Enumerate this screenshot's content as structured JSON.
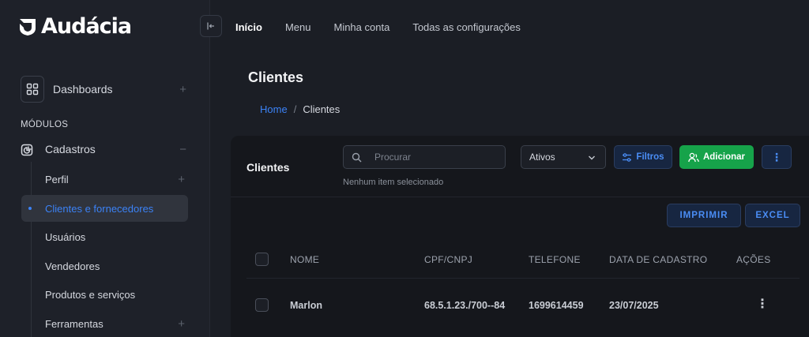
{
  "brand": {
    "name": "Audácia"
  },
  "topnav": {
    "items": [
      "Início",
      "Menu",
      "Minha conta",
      "Todas as configurações"
    ]
  },
  "sidebar": {
    "dashboards": "Dashboards",
    "section": "MÓDULOS",
    "cadastros": "Cadastros",
    "items": [
      {
        "label": "Perfil",
        "expandable": true
      },
      {
        "label": "Clientes e fornecedores",
        "active": true
      },
      {
        "label": "Usuários"
      },
      {
        "label": "Vendedores"
      },
      {
        "label": "Produtos e serviços"
      },
      {
        "label": "Ferramentas",
        "expandable": true
      }
    ]
  },
  "page": {
    "title": "Clientes",
    "breadcrumb": {
      "home": "Home",
      "sep": "/",
      "current": "Clientes"
    }
  },
  "card": {
    "title": "Clientes",
    "search_placeholder": "Procurar",
    "no_selection": "Nenhum item selecionado",
    "status_select": "Ativos",
    "filters_label": "Filtros",
    "add_label": "Adicionar",
    "print_label": "IMPRIMIR",
    "excel_label": "EXCEL"
  },
  "table": {
    "headers": [
      "NOME",
      "CPF/CNPJ",
      "TELEFONE",
      "DATA DE CADASTRO",
      "AÇÕES"
    ],
    "rows": [
      {
        "nome": "Marlon",
        "cpf": "68.5.1.23./700--84",
        "telefone": "1699614459",
        "data": "23/07/2025"
      }
    ]
  },
  "colors": {
    "accent": "#3b82f6",
    "success": "#16a34a",
    "bg": "#1b1e25",
    "card": "#15171c"
  }
}
